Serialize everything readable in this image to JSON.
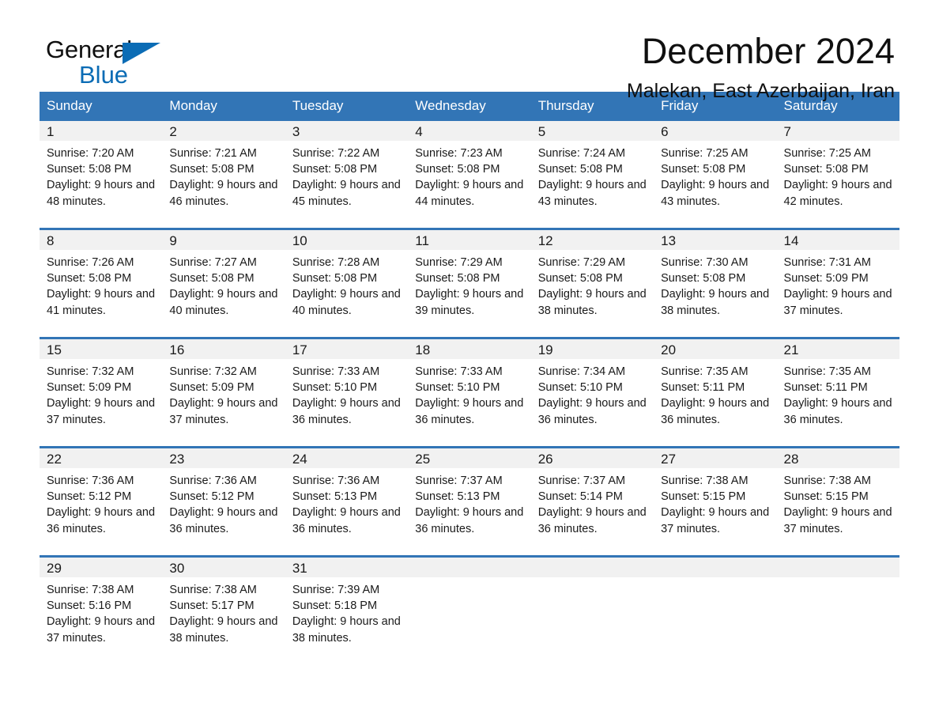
{
  "brand": {
    "name_part1": "General",
    "name_part2": "Blue",
    "accent_color": "#0b6cb5"
  },
  "header": {
    "title": "December 2024",
    "location": "Malekan, East Azerbaijan, Iran"
  },
  "theme": {
    "header_row_color": "#3275b6",
    "day_number_bar_color": "#f1f1f1",
    "text_color": "#1a1a1a"
  },
  "weekdays": [
    "Sunday",
    "Monday",
    "Tuesday",
    "Wednesday",
    "Thursday",
    "Friday",
    "Saturday"
  ],
  "labels": {
    "sunrise_prefix": "Sunrise:",
    "sunset_prefix": "Sunset:",
    "daylight_prefix": "Daylight:"
  },
  "weeks": [
    [
      {
        "day": "1",
        "sunrise": "Sunrise: 7:20 AM",
        "sunset": "Sunset: 5:08 PM",
        "daylight": "Daylight: 9 hours and 48 minutes."
      },
      {
        "day": "2",
        "sunrise": "Sunrise: 7:21 AM",
        "sunset": "Sunset: 5:08 PM",
        "daylight": "Daylight: 9 hours and 46 minutes."
      },
      {
        "day": "3",
        "sunrise": "Sunrise: 7:22 AM",
        "sunset": "Sunset: 5:08 PM",
        "daylight": "Daylight: 9 hours and 45 minutes."
      },
      {
        "day": "4",
        "sunrise": "Sunrise: 7:23 AM",
        "sunset": "Sunset: 5:08 PM",
        "daylight": "Daylight: 9 hours and 44 minutes."
      },
      {
        "day": "5",
        "sunrise": "Sunrise: 7:24 AM",
        "sunset": "Sunset: 5:08 PM",
        "daylight": "Daylight: 9 hours and 43 minutes."
      },
      {
        "day": "6",
        "sunrise": "Sunrise: 7:25 AM",
        "sunset": "Sunset: 5:08 PM",
        "daylight": "Daylight: 9 hours and 43 minutes."
      },
      {
        "day": "7",
        "sunrise": "Sunrise: 7:25 AM",
        "sunset": "Sunset: 5:08 PM",
        "daylight": "Daylight: 9 hours and 42 minutes."
      }
    ],
    [
      {
        "day": "8",
        "sunrise": "Sunrise: 7:26 AM",
        "sunset": "Sunset: 5:08 PM",
        "daylight": "Daylight: 9 hours and 41 minutes."
      },
      {
        "day": "9",
        "sunrise": "Sunrise: 7:27 AM",
        "sunset": "Sunset: 5:08 PM",
        "daylight": "Daylight: 9 hours and 40 minutes."
      },
      {
        "day": "10",
        "sunrise": "Sunrise: 7:28 AM",
        "sunset": "Sunset: 5:08 PM",
        "daylight": "Daylight: 9 hours and 40 minutes."
      },
      {
        "day": "11",
        "sunrise": "Sunrise: 7:29 AM",
        "sunset": "Sunset: 5:08 PM",
        "daylight": "Daylight: 9 hours and 39 minutes."
      },
      {
        "day": "12",
        "sunrise": "Sunrise: 7:29 AM",
        "sunset": "Sunset: 5:08 PM",
        "daylight": "Daylight: 9 hours and 38 minutes."
      },
      {
        "day": "13",
        "sunrise": "Sunrise: 7:30 AM",
        "sunset": "Sunset: 5:08 PM",
        "daylight": "Daylight: 9 hours and 38 minutes."
      },
      {
        "day": "14",
        "sunrise": "Sunrise: 7:31 AM",
        "sunset": "Sunset: 5:09 PM",
        "daylight": "Daylight: 9 hours and 37 minutes."
      }
    ],
    [
      {
        "day": "15",
        "sunrise": "Sunrise: 7:32 AM",
        "sunset": "Sunset: 5:09 PM",
        "daylight": "Daylight: 9 hours and 37 minutes."
      },
      {
        "day": "16",
        "sunrise": "Sunrise: 7:32 AM",
        "sunset": "Sunset: 5:09 PM",
        "daylight": "Daylight: 9 hours and 37 minutes."
      },
      {
        "day": "17",
        "sunrise": "Sunrise: 7:33 AM",
        "sunset": "Sunset: 5:10 PM",
        "daylight": "Daylight: 9 hours and 36 minutes."
      },
      {
        "day": "18",
        "sunrise": "Sunrise: 7:33 AM",
        "sunset": "Sunset: 5:10 PM",
        "daylight": "Daylight: 9 hours and 36 minutes."
      },
      {
        "day": "19",
        "sunrise": "Sunrise: 7:34 AM",
        "sunset": "Sunset: 5:10 PM",
        "daylight": "Daylight: 9 hours and 36 minutes."
      },
      {
        "day": "20",
        "sunrise": "Sunrise: 7:35 AM",
        "sunset": "Sunset: 5:11 PM",
        "daylight": "Daylight: 9 hours and 36 minutes."
      },
      {
        "day": "21",
        "sunrise": "Sunrise: 7:35 AM",
        "sunset": "Sunset: 5:11 PM",
        "daylight": "Daylight: 9 hours and 36 minutes."
      }
    ],
    [
      {
        "day": "22",
        "sunrise": "Sunrise: 7:36 AM",
        "sunset": "Sunset: 5:12 PM",
        "daylight": "Daylight: 9 hours and 36 minutes."
      },
      {
        "day": "23",
        "sunrise": "Sunrise: 7:36 AM",
        "sunset": "Sunset: 5:12 PM",
        "daylight": "Daylight: 9 hours and 36 minutes."
      },
      {
        "day": "24",
        "sunrise": "Sunrise: 7:36 AM",
        "sunset": "Sunset: 5:13 PM",
        "daylight": "Daylight: 9 hours and 36 minutes."
      },
      {
        "day": "25",
        "sunrise": "Sunrise: 7:37 AM",
        "sunset": "Sunset: 5:13 PM",
        "daylight": "Daylight: 9 hours and 36 minutes."
      },
      {
        "day": "26",
        "sunrise": "Sunrise: 7:37 AM",
        "sunset": "Sunset: 5:14 PM",
        "daylight": "Daylight: 9 hours and 36 minutes."
      },
      {
        "day": "27",
        "sunrise": "Sunrise: 7:38 AM",
        "sunset": "Sunset: 5:15 PM",
        "daylight": "Daylight: 9 hours and 37 minutes."
      },
      {
        "day": "28",
        "sunrise": "Sunrise: 7:38 AM",
        "sunset": "Sunset: 5:15 PM",
        "daylight": "Daylight: 9 hours and 37 minutes."
      }
    ],
    [
      {
        "day": "29",
        "sunrise": "Sunrise: 7:38 AM",
        "sunset": "Sunset: 5:16 PM",
        "daylight": "Daylight: 9 hours and 37 minutes."
      },
      {
        "day": "30",
        "sunrise": "Sunrise: 7:38 AM",
        "sunset": "Sunset: 5:17 PM",
        "daylight": "Daylight: 9 hours and 38 minutes."
      },
      {
        "day": "31",
        "sunrise": "Sunrise: 7:39 AM",
        "sunset": "Sunset: 5:18 PM",
        "daylight": "Daylight: 9 hours and 38 minutes."
      },
      {
        "day": "",
        "sunrise": "",
        "sunset": "",
        "daylight": ""
      },
      {
        "day": "",
        "sunrise": "",
        "sunset": "",
        "daylight": ""
      },
      {
        "day": "",
        "sunrise": "",
        "sunset": "",
        "daylight": ""
      },
      {
        "day": "",
        "sunrise": "",
        "sunset": "",
        "daylight": ""
      }
    ]
  ]
}
